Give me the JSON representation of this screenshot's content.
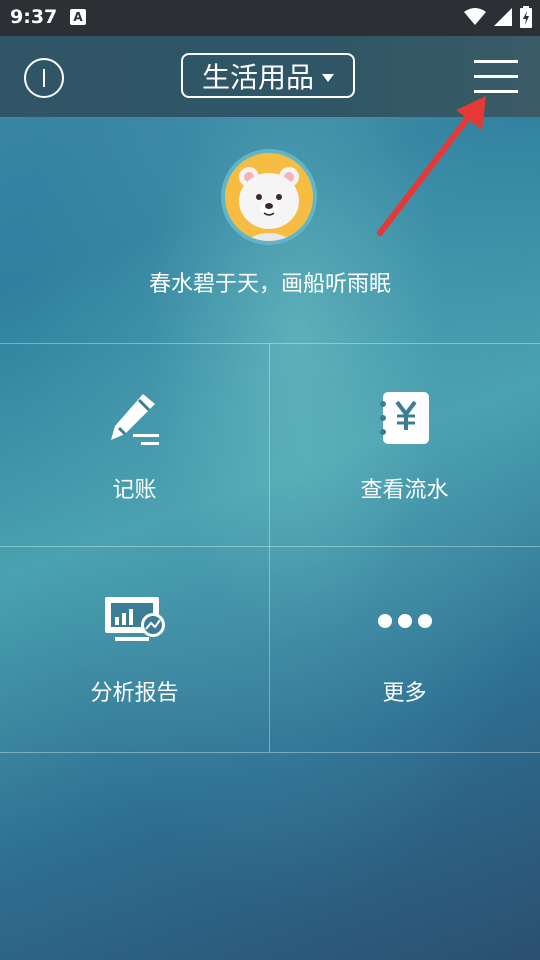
{
  "status": {
    "time": "9:37",
    "notification_badge": "A"
  },
  "app_bar": {
    "book_name": "生活用品"
  },
  "profile": {
    "motto": "春水碧于天，画船听雨眠"
  },
  "grid": {
    "items": [
      {
        "label": "记账",
        "icon": "pen-icon"
      },
      {
        "label": "查看流水",
        "icon": "ledger-yen-icon"
      },
      {
        "label": "分析报告",
        "icon": "report-chart-icon"
      },
      {
        "label": "更多",
        "icon": "more-dots-icon"
      }
    ]
  },
  "annotation": {
    "arrow_color": "#e53935"
  }
}
